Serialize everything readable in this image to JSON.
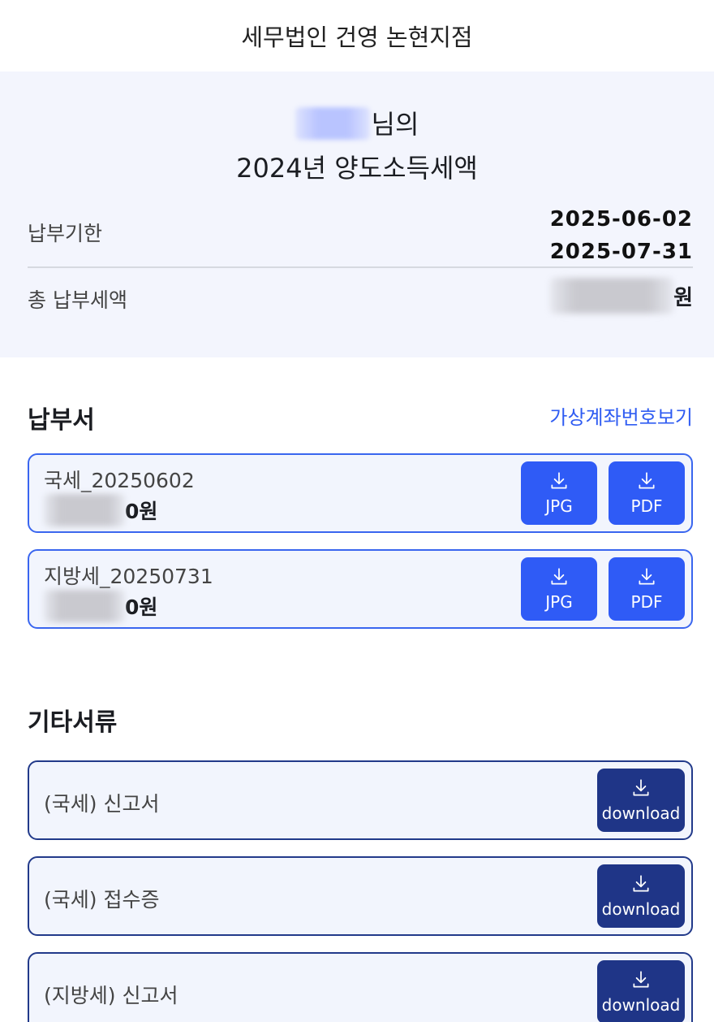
{
  "header": {
    "title": "세무법인 건영 논현지점"
  },
  "summary": {
    "name_suffix": "님의",
    "subtitle": "2024년 양도소득세액",
    "deadline_label": "납부기한",
    "deadline_dates": [
      "2025-06-02",
      "2025-07-31"
    ],
    "total_label": "총 납부세액",
    "total_unit": "원"
  },
  "payment": {
    "title": "납부서",
    "link": "가상계좌번호보기",
    "items": [
      {
        "title": "국세_20250602",
        "amount_visible": "0원",
        "jpg_label": "JPG",
        "pdf_label": "PDF"
      },
      {
        "title": "지방세_20250731",
        "amount_visible": "0원",
        "jpg_label": "JPG",
        "pdf_label": "PDF"
      }
    ]
  },
  "documents": {
    "title": "기타서류",
    "items": [
      {
        "title": "(국세) 신고서",
        "button_label": "download"
      },
      {
        "title": "(국세) 접수증",
        "button_label": "download"
      },
      {
        "title": "(지방세) 신고서",
        "button_label": "download"
      }
    ]
  },
  "colors": {
    "accent": "#2f5bf6",
    "dark_accent": "#1f3587",
    "summary_bg": "#f3f5fd"
  }
}
